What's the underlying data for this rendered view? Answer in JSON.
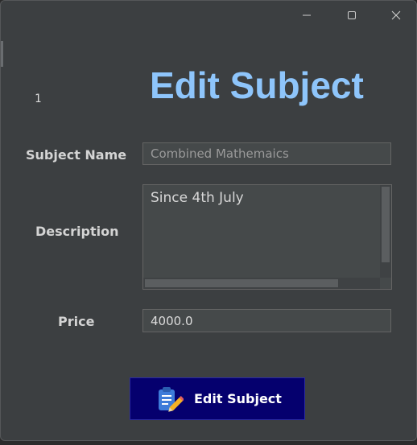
{
  "window": {
    "controls": [
      "minimize-icon",
      "maximize-icon",
      "close-icon"
    ]
  },
  "record": {
    "id": "1"
  },
  "heading": "Edit Subject",
  "form": {
    "subject_name": {
      "label": "Subject Name",
      "value": "Combined Mathemaics"
    },
    "description": {
      "label": "Description",
      "value": "Since 4th July"
    },
    "price": {
      "label": "Price",
      "value": "4000.0"
    }
  },
  "action": {
    "label": "Edit Subject",
    "icon": "clipboard-edit-icon"
  },
  "colors": {
    "window_bg": "#3c3f41",
    "heading": "#8ec5fb",
    "input_bg": "#45494a",
    "button_bg": "#05006e"
  }
}
